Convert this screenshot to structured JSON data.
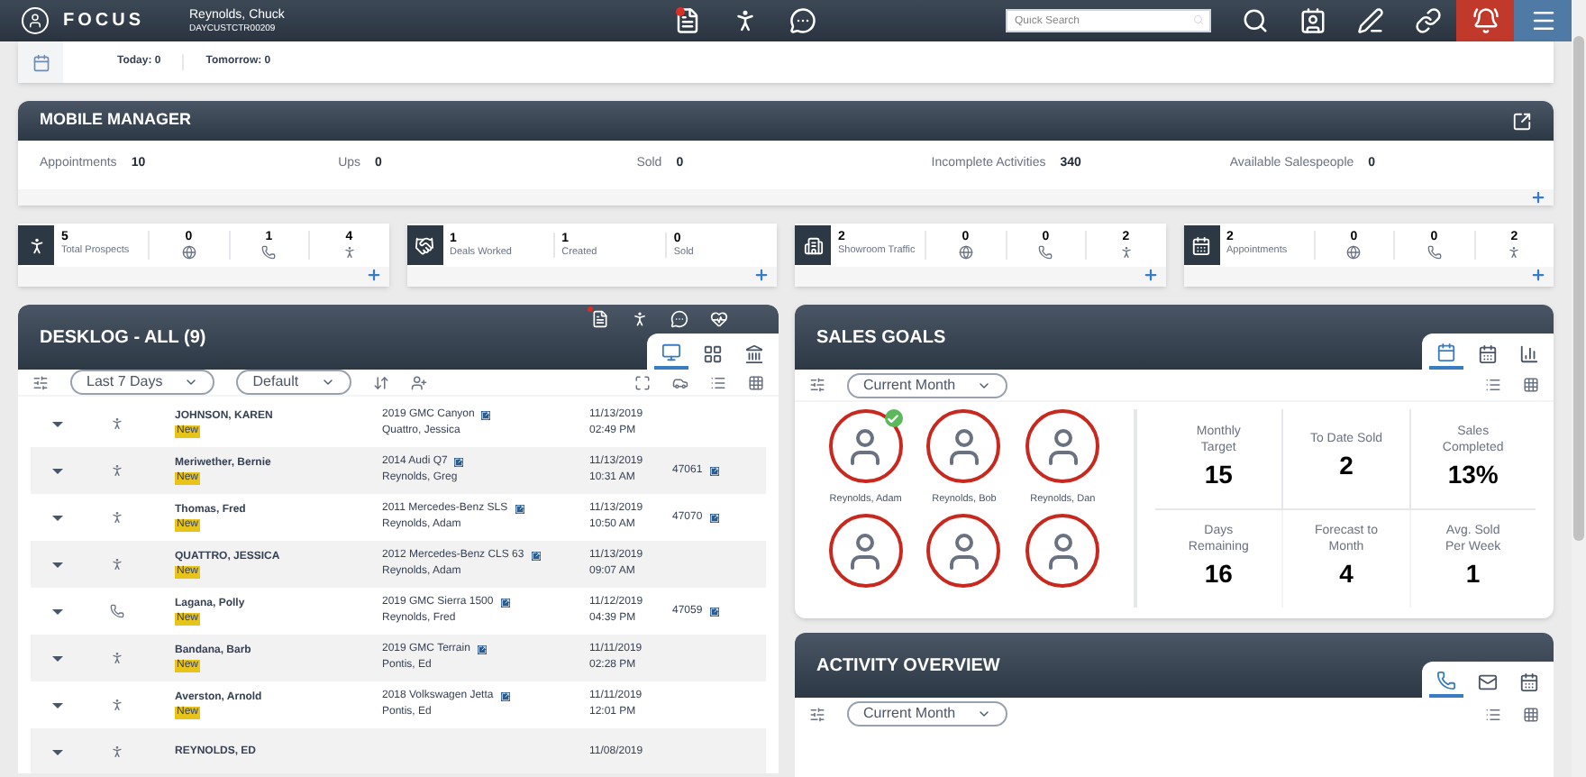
{
  "header": {
    "brand": "FOCUS",
    "user_name": "Reynolds, Chuck",
    "user_id": "DAYCUSTCTR00209",
    "search": {
      "placeholder": "Quick Search"
    }
  },
  "calendar_strip": {
    "today": "Today: 0",
    "tomorrow": "Tomorrow: 0"
  },
  "mobile_manager": {
    "title": "MOBILE MANAGER",
    "stats": [
      {
        "label": "Appointments",
        "value": "10"
      },
      {
        "label": "Ups",
        "value": "0"
      },
      {
        "label": "Sold",
        "value": "0"
      },
      {
        "label": "Incomplete Activities",
        "value": "340"
      },
      {
        "label": "Available Salespeople",
        "value": "0"
      }
    ]
  },
  "stat_cards": [
    {
      "kind": "prospects",
      "items": [
        {
          "kind": "label",
          "value": "5",
          "label": "Total Prospects"
        },
        {
          "kind": "web",
          "value": "0"
        },
        {
          "kind": "phone",
          "value": "1"
        },
        {
          "kind": "walk",
          "value": "4"
        }
      ]
    },
    {
      "kind": "deals",
      "items": [
        {
          "kind": "label",
          "value": "1",
          "label": "Deals Worked"
        },
        {
          "kind": "label",
          "value": "1",
          "label": "Created"
        },
        {
          "kind": "label",
          "value": "0",
          "label": "Sold"
        }
      ]
    },
    {
      "kind": "showroom",
      "items": [
        {
          "kind": "label",
          "value": "2",
          "label": "Showroom Traffic"
        },
        {
          "kind": "web",
          "value": "0"
        },
        {
          "kind": "phone",
          "value": "0"
        },
        {
          "kind": "walk",
          "value": "2"
        }
      ]
    },
    {
      "kind": "appointments",
      "items": [
        {
          "kind": "label",
          "value": "2",
          "label": "Appointments"
        },
        {
          "kind": "web",
          "value": "0"
        },
        {
          "kind": "phone",
          "value": "0"
        },
        {
          "kind": "walk",
          "value": "2"
        }
      ]
    }
  ],
  "desklog": {
    "title": "DESKLOG - ALL (9)",
    "view_tabs": [
      {
        "kind": "monitor",
        "selected": true
      },
      {
        "kind": "grid",
        "selected": false
      },
      {
        "kind": "building",
        "selected": false
      }
    ],
    "filters": [
      "Last 7 Days",
      "Default"
    ],
    "rows": [
      {
        "kind": "walk",
        "name": "JOHNSON, KAREN",
        "status": "New",
        "vehicle": "2019 GMC Canyon",
        "salesperson": "Quattro, Jessica",
        "date": "11/13/2019",
        "time": "02:49 PM"
      },
      {
        "kind": "walk",
        "name": "Meriwether, Bernie",
        "status": "New",
        "vehicle": "2014 Audi Q7",
        "salesperson": "Reynolds, Greg",
        "date": "11/13/2019",
        "time": "10:31 AM",
        "deal": "47061"
      },
      {
        "kind": "walk",
        "name": "Thomas, Fred",
        "status": "New",
        "vehicle": "2011 Mercedes-Benz SLS",
        "salesperson": "Reynolds, Adam",
        "date": "11/13/2019",
        "time": "10:50 AM",
        "deal": "47070"
      },
      {
        "kind": "walk",
        "name": "QUATTRO, JESSICA",
        "status": "New",
        "vehicle": "2012 Mercedes-Benz CLS 63",
        "salesperson": "Reynolds, Adam",
        "date": "11/13/2019",
        "time": "09:07 AM"
      },
      {
        "kind": "phone",
        "name": "Lagana, Polly",
        "status": "New",
        "vehicle": "2019 GMC Sierra 1500",
        "salesperson": "Reynolds, Fred",
        "date": "11/12/2019",
        "time": "04:39 PM",
        "deal": "47059"
      },
      {
        "kind": "walk",
        "name": "Bandana, Barb",
        "status": "New",
        "vehicle": "2019 GMC Terrain",
        "salesperson": "Pontis, Ed",
        "date": "11/11/2019",
        "time": "02:28 PM"
      },
      {
        "kind": "walk",
        "name": "Averston, Arnold",
        "status": "New",
        "vehicle": "2018 Volkswagen Jetta",
        "salesperson": "Pontis, Ed",
        "date": "11/11/2019",
        "time": "12:01 PM"
      },
      {
        "kind": "walk",
        "name": "REYNOLDS, ED",
        "date": "11/08/2019"
      }
    ]
  },
  "sales_goals": {
    "title": "SALES GOALS",
    "view_tabs": [
      {
        "kind": "day",
        "selected": true
      },
      {
        "kind": "week",
        "selected": false
      },
      {
        "kind": "chart",
        "selected": false
      }
    ],
    "period": "Current Month",
    "people": [
      {
        "name": "Reynolds, Adam",
        "checked": true
      },
      {
        "name": "Reynolds, Bob",
        "checked": false
      },
      {
        "name": "Reynolds, Dan",
        "checked": false
      },
      {
        "checked": false
      },
      {
        "checked": false
      },
      {
        "checked": false
      }
    ],
    "metrics": [
      {
        "label": "Monthly Target",
        "value": "15"
      },
      {
        "label": "To Date Sold",
        "value": "2"
      },
      {
        "label": "Sales Completed",
        "value": "13%"
      },
      {
        "label": "Days Remaining",
        "value": "16"
      },
      {
        "label": "Forecast to Month",
        "value": "4"
      },
      {
        "label": "Avg. Sold Per Week",
        "value": "1"
      }
    ]
  },
  "activity_overview": {
    "title": "ACTIVITY OVERVIEW",
    "view_tabs": [
      {
        "kind": "phone",
        "selected": true
      },
      {
        "kind": "mail",
        "selected": false
      },
      {
        "kind": "calendar",
        "selected": false
      }
    ],
    "period": "Current Month"
  }
}
